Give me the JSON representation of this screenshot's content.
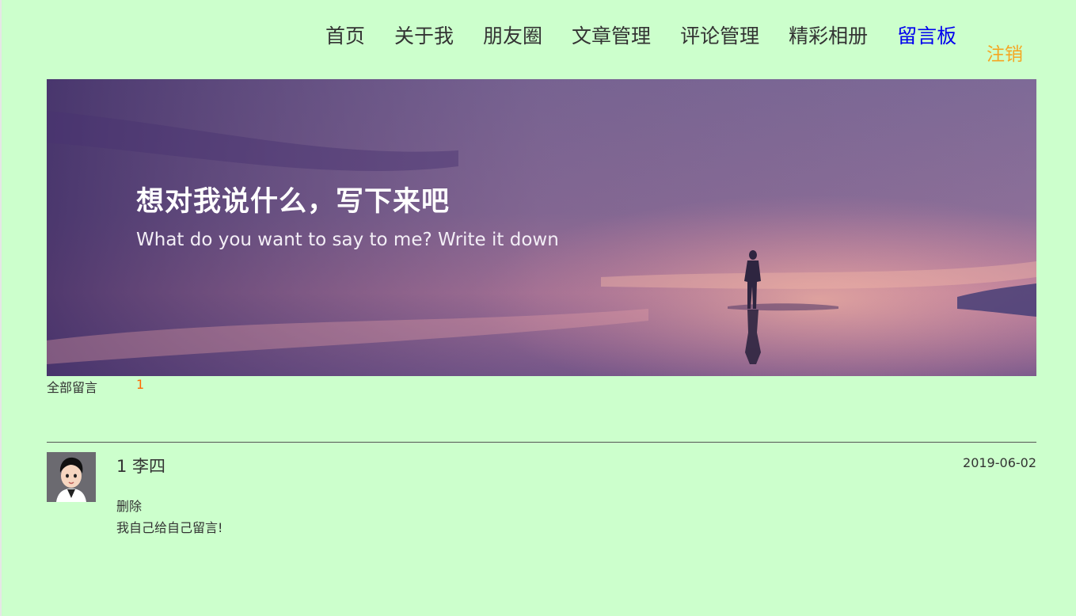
{
  "nav": {
    "items": [
      {
        "label": "首页"
      },
      {
        "label": "关于我"
      },
      {
        "label": "朋友圈"
      },
      {
        "label": "文章管理"
      },
      {
        "label": "评论管理"
      },
      {
        "label": "精彩相册"
      },
      {
        "label": "留言板"
      }
    ],
    "active_index": 6,
    "logout_label": "注销"
  },
  "banner": {
    "title": "想对我说什么，写下来吧",
    "subtitle": "What do you want to say to me? Write it down"
  },
  "messages_header": {
    "label": "全部留言",
    "count": "1"
  },
  "messages": [
    {
      "author": "1 李四",
      "date": "2019-06-02",
      "delete_label": "删除",
      "text": "我自己给自己留言!"
    }
  ],
  "colors": {
    "background": "#ccffcc",
    "active_nav": "#0000ee",
    "logout": "#f5a623",
    "count": "#ff6a00"
  }
}
